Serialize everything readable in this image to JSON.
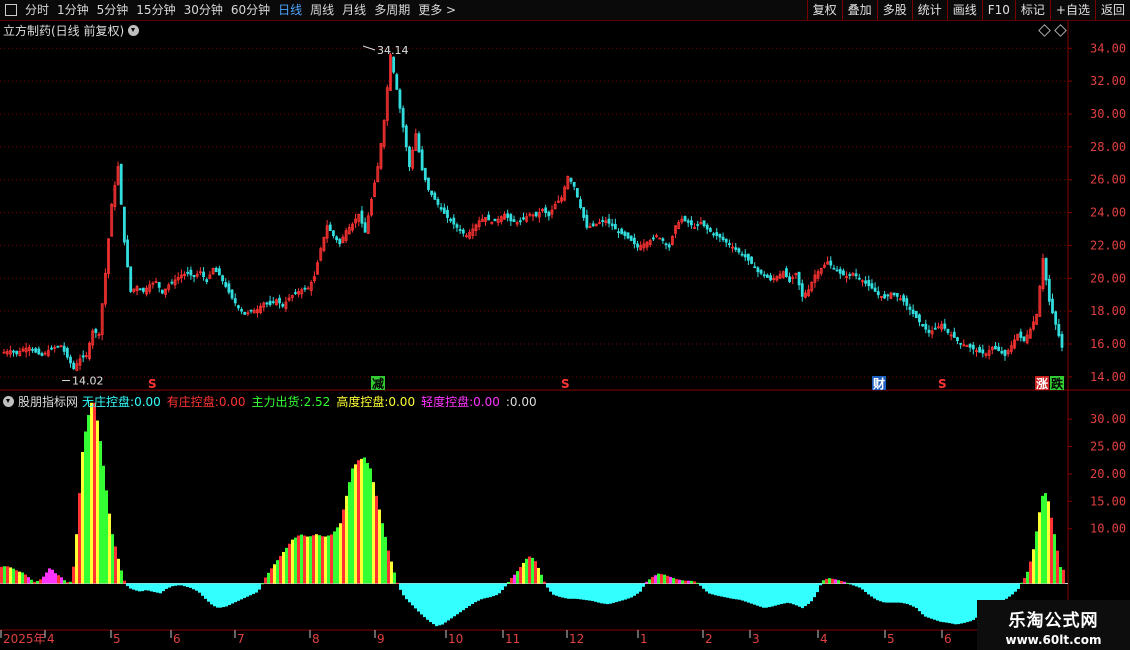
{
  "toolbar": {
    "periods": [
      {
        "label": "分时",
        "active": false
      },
      {
        "label": "1分钟",
        "active": false
      },
      {
        "label": "5分钟",
        "active": false
      },
      {
        "label": "15分钟",
        "active": false
      },
      {
        "label": "30分钟",
        "active": false
      },
      {
        "label": "60分钟",
        "active": false
      },
      {
        "label": "日线",
        "active": true
      },
      {
        "label": "周线",
        "active": false
      },
      {
        "label": "月线",
        "active": false
      },
      {
        "label": "多周期",
        "active": false
      },
      {
        "label": "更多 >",
        "active": false
      }
    ],
    "actions": [
      "复权",
      "叠加",
      "多股",
      "统计",
      "画线",
      "F10",
      "标记",
      "+自选",
      "返回"
    ]
  },
  "stock": {
    "title": "立方制药(日线 前复权)",
    "high_label": "34.14",
    "low_label": "14.02"
  },
  "price_axis": {
    "ylim": [
      13.2,
      35.6
    ],
    "ticks": [
      "34.00",
      "32.00",
      "30.00",
      "28.00",
      "26.00",
      "24.00",
      "22.00",
      "20.00",
      "18.00",
      "16.00",
      "14.00"
    ]
  },
  "event_markers": [
    {
      "label": "S",
      "color": "#ff3333",
      "bg": "",
      "at": 148
    },
    {
      "label": "减",
      "color": "#000000",
      "bg": "#33cc33",
      "at": 372
    },
    {
      "label": "S",
      "color": "#ff3333",
      "bg": "",
      "at": 561
    },
    {
      "label": "财",
      "color": "#ffffff",
      "bg": "#1f5fbf",
      "at": 873
    },
    {
      "label": "S",
      "color": "#ff3333",
      "bg": "",
      "at": 938
    },
    {
      "label": "涨",
      "color": "#ffffff",
      "bg": "#cc2222",
      "at": 1036
    },
    {
      "label": "跌",
      "color": "#000000",
      "bg": "#33cc33",
      "at": 1051
    }
  ],
  "indicator": {
    "name": "股朋指标网",
    "legend": [
      {
        "label": "无庄控盘: ",
        "value": "0.00",
        "color": "#33ffff"
      },
      {
        "label": "有庄控盘: ",
        "value": "0.00",
        "color": "#ff3333"
      },
      {
        "label": "主力出货: ",
        "value": "2.52",
        "color": "#33ff33"
      },
      {
        "label": "高度控盘: ",
        "value": "0.00",
        "color": "#ffff33"
      },
      {
        "label": "轻度控盘: ",
        "value": "0.00",
        "color": "#ff33ff"
      },
      {
        "label": ": ",
        "value": "0.00",
        "color": "#dddddd"
      }
    ],
    "axis_ticks": [
      "30.00",
      "25.00",
      "20.00",
      "15.00",
      "10.00"
    ],
    "ylim": [
      -8.5,
      33.5
    ]
  },
  "date_axis": [
    {
      "label": "2025年",
      "at": 3
    },
    {
      "label": "4",
      "at": 47
    },
    {
      "label": "5",
      "at": 113
    },
    {
      "label": "6",
      "at": 173
    },
    {
      "label": "7",
      "at": 237
    },
    {
      "label": "8",
      "at": 312
    },
    {
      "label": "9",
      "at": 377
    },
    {
      "label": "10",
      "at": 448
    },
    {
      "label": "11",
      "at": 505
    },
    {
      "label": "12",
      "at": 569
    },
    {
      "label": "1",
      "at": 640
    },
    {
      "label": "2",
      "at": 705
    },
    {
      "label": "3",
      "at": 752
    },
    {
      "label": "4",
      "at": 820
    },
    {
      "label": "5",
      "at": 887
    },
    {
      "label": "6",
      "at": 944
    }
  ],
  "watermark": {
    "line1": "乐淘公式网",
    "line2": "www.60lt.com"
  },
  "colors": {
    "up": "#ff3333",
    "down": "#33dddd",
    "grid": "#7a0000",
    "axis": "#c8c8c8"
  },
  "chart_data": [
    {
      "type": "candlestick",
      "title": "立方制药(日线 前复权)",
      "x_range": [
        "2025年3月",
        "2025年6月"
      ],
      "ylim": [
        13.2,
        35.6
      ],
      "annotations": [
        {
          "label": "34.14",
          "kind": "high"
        },
        {
          "label": "14.02",
          "kind": "low"
        }
      ],
      "anchor_closes": [
        15.5,
        15.6,
        15.4,
        15.7,
        15.8,
        15.5,
        15.3,
        15.6,
        15.8,
        15.9,
        15.2,
        14.5,
        15.1,
        15.3,
        16.8,
        16.6,
        20.3,
        24.5,
        26.8,
        22.2,
        19.2,
        19.5,
        19.2,
        19.6,
        19.8,
        19.1,
        19.6,
        19.9,
        20.2,
        20.3,
        20.1,
        20.4,
        19.8,
        20.6,
        20.2,
        19.5,
        18.8,
        18.2,
        17.8,
        18.0,
        18.1,
        18.5,
        18.4,
        18.7,
        18.3,
        18.8,
        19.1,
        19.3,
        19.4,
        20.1,
        21.8,
        23.2,
        22.6,
        22.1,
        22.9,
        23.3,
        23.9,
        22.8,
        24.8,
        26.8,
        29.6,
        33.6,
        31.5,
        29.2,
        26.8,
        28.8,
        26.6,
        25.4,
        24.8,
        24.2,
        23.7,
        23.3,
        22.9,
        22.6,
        23.0,
        23.5,
        23.7,
        23.4,
        23.6,
        23.9,
        23.5,
        23.4,
        23.6,
        23.9,
        23.8,
        24.2,
        23.8,
        24.5,
        24.9,
        26.2,
        25.6,
        24.3,
        23.1,
        23.2,
        23.4,
        23.5,
        23.2,
        22.8,
        22.6,
        22.3,
        21.9,
        22.1,
        22.3,
        22.6,
        22.3,
        21.9,
        23.2,
        23.6,
        23.4,
        23.1,
        23.4,
        23.0,
        22.7,
        22.5,
        22.2,
        21.9,
        21.6,
        21.3,
        20.9,
        20.4,
        20.2,
        19.9,
        20.1,
        20.4,
        19.8,
        20.3,
        18.9,
        19.3,
        20.2,
        20.6,
        21.0,
        20.6,
        20.3,
        20.1,
        20.3,
        20.0,
        19.7,
        19.4,
        19.0,
        18.8,
        19.1,
        18.9,
        18.6,
        18.1,
        17.6,
        17.1,
        16.7,
        16.9,
        17.2,
        16.7,
        16.4,
        16.0,
        15.9,
        15.7,
        15.5,
        15.4,
        15.8,
        15.6,
        15.3,
        15.9,
        16.6,
        16.2,
        16.9,
        17.8,
        21.2,
        18.6,
        17.2,
        15.8
      ]
    },
    {
      "type": "bar",
      "title": "股朋指标网",
      "series": [
        {
          "name": "无庄控盘",
          "color": "#33ffff"
        },
        {
          "name": "有庄控盘",
          "color": "#ff3333"
        },
        {
          "name": "主力出货",
          "color": "#33ff33"
        },
        {
          "name": "高度控盘",
          "color": "#ffff33"
        },
        {
          "name": "轻度控盘",
          "color": "#ff33ff"
        }
      ],
      "ylim": [
        -8.5,
        33.5
      ],
      "anchors": [
        [
          0,
          3
        ],
        [
          6,
          3.2
        ],
        [
          12,
          2.8
        ],
        [
          18,
          2.2
        ],
        [
          22,
          2.0
        ],
        [
          26,
          1.5
        ],
        [
          30,
          0.8
        ],
        [
          34,
          0.3
        ],
        [
          38,
          0.5
        ],
        [
          42,
          1.0
        ],
        [
          46,
          2.0
        ],
        [
          50,
          3.0
        ],
        [
          54,
          2.0
        ],
        [
          58,
          1.5
        ],
        [
          62,
          1.0
        ],
        [
          66,
          0.2
        ],
        [
          70,
          0.3
        ],
        [
          74,
          4.0
        ],
        [
          78,
          14.0
        ],
        [
          82,
          24.0
        ],
        [
          86,
          29.0
        ],
        [
          90,
          32.5
        ],
        [
          92,
          33.5
        ],
        [
          94,
          33.0
        ],
        [
          96,
          31.0
        ],
        [
          100,
          26.0
        ],
        [
          104,
          20.0
        ],
        [
          108,
          14.0
        ],
        [
          112,
          9.0
        ],
        [
          116,
          6.0
        ],
        [
          120,
          3.0
        ],
        [
          124,
          0.5
        ],
        [
          128,
          -0.8
        ],
        [
          134,
          -1.2
        ],
        [
          140,
          -1.5
        ],
        [
          146,
          -1.2
        ],
        [
          152,
          -1.5
        ],
        [
          160,
          -1.8
        ],
        [
          166,
          -1.0
        ],
        [
          172,
          -0.5
        ],
        [
          180,
          -0.3
        ],
        [
          190,
          -0.8
        ],
        [
          198,
          -1.5
        ],
        [
          206,
          -3.0
        ],
        [
          212,
          -4.0
        ],
        [
          218,
          -4.5
        ],
        [
          226,
          -4.2
        ],
        [
          234,
          -3.5
        ],
        [
          240,
          -3.0
        ],
        [
          246,
          -2.5
        ],
        [
          252,
          -2.0
        ],
        [
          258,
          -1.5
        ],
        [
          264,
          0.8
        ],
        [
          270,
          2.5
        ],
        [
          276,
          4.0
        ],
        [
          284,
          6.0
        ],
        [
          292,
          8.0
        ],
        [
          300,
          9.0
        ],
        [
          308,
          8.5
        ],
        [
          316,
          9.0
        ],
        [
          324,
          8.5
        ],
        [
          332,
          9.0
        ],
        [
          340,
          11.0
        ],
        [
          346,
          16.0
        ],
        [
          352,
          21.0
        ],
        [
          358,
          22.5
        ],
        [
          364,
          23.0
        ],
        [
          370,
          21.0
        ],
        [
          376,
          16.0
        ],
        [
          382,
          11.0
        ],
        [
          388,
          6.0
        ],
        [
          394,
          2.0
        ],
        [
          398,
          -0.5
        ],
        [
          404,
          -2.5
        ],
        [
          412,
          -4.0
        ],
        [
          420,
          -5.5
        ],
        [
          428,
          -6.8
        ],
        [
          436,
          -7.8
        ],
        [
          442,
          -7.5
        ],
        [
          450,
          -6.5
        ],
        [
          458,
          -5.5
        ],
        [
          466,
          -4.5
        ],
        [
          474,
          -3.5
        ],
        [
          482,
          -2.8
        ],
        [
          490,
          -2.5
        ],
        [
          498,
          -2.0
        ],
        [
          504,
          -0.8
        ],
        [
          510,
          0.8
        ],
        [
          516,
          2.0
        ],
        [
          522,
          3.5
        ],
        [
          528,
          5.0
        ],
        [
          534,
          4.5
        ],
        [
          540,
          2.0
        ],
        [
          546,
          -0.5
        ],
        [
          552,
          -2.0
        ],
        [
          560,
          -2.5
        ],
        [
          568,
          -2.8
        ],
        [
          576,
          -2.8
        ],
        [
          584,
          -3.0
        ],
        [
          592,
          -3.2
        ],
        [
          600,
          -3.6
        ],
        [
          608,
          -3.8
        ],
        [
          616,
          -3.4
        ],
        [
          624,
          -3.0
        ],
        [
          632,
          -2.5
        ],
        [
          640,
          -1.5
        ],
        [
          646,
          0.3
        ],
        [
          652,
          1.2
        ],
        [
          658,
          1.8
        ],
        [
          664,
          1.6
        ],
        [
          670,
          1.2
        ],
        [
          676,
          0.8
        ],
        [
          684,
          0.5
        ],
        [
          690,
          0.5
        ],
        [
          696,
          0.3
        ],
        [
          702,
          -0.8
        ],
        [
          708,
          -1.8
        ],
        [
          716,
          -2.2
        ],
        [
          724,
          -2.5
        ],
        [
          732,
          -2.8
        ],
        [
          740,
          -3.0
        ],
        [
          748,
          -3.5
        ],
        [
          756,
          -4.0
        ],
        [
          764,
          -4.5
        ],
        [
          772,
          -4.2
        ],
        [
          780,
          -3.8
        ],
        [
          788,
          -3.5
        ],
        [
          796,
          -4.0
        ],
        [
          802,
          -4.5
        ],
        [
          810,
          -3.5
        ],
        [
          816,
          -2.0
        ],
        [
          822,
          0.5
        ],
        [
          828,
          1.0
        ],
        [
          834,
          0.8
        ],
        [
          840,
          0.5
        ],
        [
          846,
          0.2
        ],
        [
          852,
          -0.3
        ],
        [
          860,
          -0.8
        ],
        [
          868,
          -2.0
        ],
        [
          876,
          -3.0
        ],
        [
          884,
          -3.5
        ],
        [
          892,
          -3.5
        ],
        [
          900,
          -3.5
        ],
        [
          908,
          -3.8
        ],
        [
          916,
          -4.5
        ],
        [
          924,
          -6.0
        ],
        [
          932,
          -6.5
        ],
        [
          940,
          -7.0
        ],
        [
          948,
          -7.2
        ],
        [
          956,
          -7.5
        ],
        [
          964,
          -7.2
        ],
        [
          972,
          -6.8
        ],
        [
          978,
          -6.0
        ],
        [
          984,
          -5.5
        ],
        [
          990,
          -4.5
        ],
        [
          998,
          -3.5
        ],
        [
          1006,
          -2.8
        ],
        [
          1012,
          -2.0
        ],
        [
          1018,
          -1.0
        ],
        [
          1022,
          0.5
        ],
        [
          1026,
          1.5
        ],
        [
          1030,
          4.0
        ],
        [
          1034,
          7.0
        ],
        [
          1038,
          12.0
        ],
        [
          1042,
          16.0
        ],
        [
          1044,
          17.0
        ],
        [
          1048,
          15.0
        ],
        [
          1052,
          11.0
        ],
        [
          1056,
          7.0
        ],
        [
          1060,
          3.0
        ],
        [
          1063,
          2.5
        ]
      ]
    }
  ]
}
